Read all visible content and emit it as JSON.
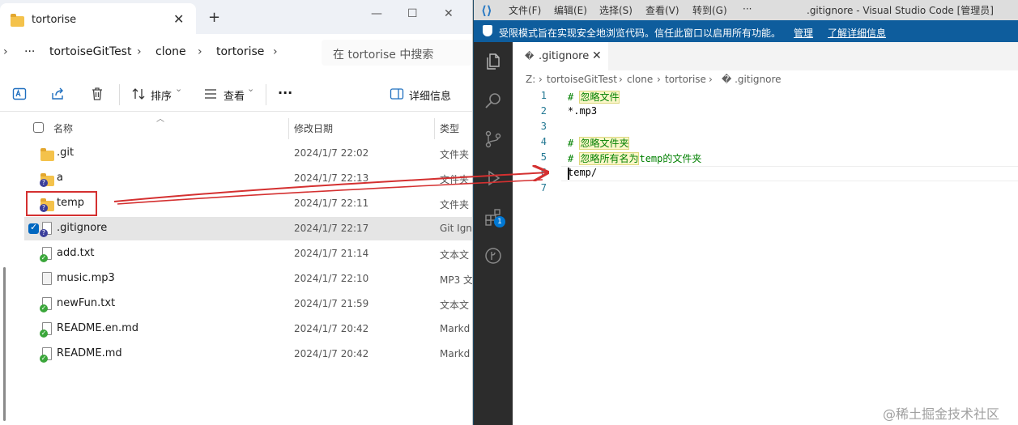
{
  "explorer": {
    "tab_title": "tortorise",
    "tab_close": "✕",
    "new_tab": "+",
    "window_controls": {
      "minimize": "—",
      "maximize": "☐",
      "close": "✕"
    },
    "breadcrumb": {
      "overflow": "···",
      "items": [
        "tortoiseGitTest",
        "clone",
        "tortorise"
      ],
      "separator": "›"
    },
    "search_placeholder": "在 tortorise 中搜索",
    "toolbar": {
      "sort_label": "排序",
      "view_label": "查看",
      "more": "···",
      "details_label": "详细信息",
      "dropdown": "⌄"
    },
    "columns": {
      "name": "名称",
      "date": "修改日期",
      "type": "类型"
    },
    "files": [
      {
        "name": ".git",
        "date": "2024/1/7 22:02",
        "type": "文件夹",
        "icon": "folder-icon",
        "overlay": "none"
      },
      {
        "name": "a",
        "date": "2024/1/7 22:13",
        "type": "文件夹",
        "icon": "folder-icon",
        "overlay": "unversioned"
      },
      {
        "name": "temp",
        "date": "2024/1/7 22:11",
        "type": "文件夹",
        "icon": "folder-icon",
        "overlay": "unversioned"
      },
      {
        "name": ".gitignore",
        "date": "2024/1/7 22:17",
        "type": "Git Ignore",
        "icon": "file-icon",
        "overlay": "unversioned",
        "selected": true
      },
      {
        "name": "add.txt",
        "date": "2024/1/7 21:14",
        "type": "文本文",
        "icon": "file-icon",
        "overlay": "normal"
      },
      {
        "name": "music.mp3",
        "date": "2024/1/7 22:10",
        "type": "MP3 文",
        "icon": "media-file-icon",
        "overlay": "none"
      },
      {
        "name": "newFun.txt",
        "date": "2024/1/7 21:59",
        "type": "文本文",
        "icon": "file-icon",
        "overlay": "normal"
      },
      {
        "name": "README.en.md",
        "date": "2024/1/7 20:42",
        "type": "Markd",
        "icon": "file-icon",
        "overlay": "normal"
      },
      {
        "name": "README.md",
        "date": "2024/1/7 20:42",
        "type": "Markd",
        "icon": "file-icon",
        "overlay": "normal"
      }
    ]
  },
  "vscode": {
    "menu": [
      "文件(F)",
      "编辑(E)",
      "选择(S)",
      "查看(V)",
      "转到(G)",
      "···"
    ],
    "window_title": ".gitignore - Visual Studio Code [管理员]",
    "banner": {
      "text": "受限模式旨在实现安全地浏览代码。信任此窗口以启用所有功能。",
      "manage_link": "管理",
      "learn_link": "了解详细信息"
    },
    "extensions_badge": "1",
    "tab": {
      "icon": "�",
      "title": ".gitignore",
      "close": "✕"
    },
    "breadcrumb": [
      "Z:",
      "tortoiseGitTest",
      "clone",
      "tortorise",
      "� .gitignore"
    ],
    "breadcrumb_sep": "›",
    "lines": [
      {
        "num": "1",
        "prefix": "# ",
        "highlight": "忽略文件",
        "suffix": "",
        "comment": true
      },
      {
        "num": "2",
        "prefix": "*.mp3",
        "highlight": "",
        "suffix": "",
        "comment": false
      },
      {
        "num": "3",
        "prefix": "",
        "highlight": "",
        "suffix": "",
        "comment": false
      },
      {
        "num": "4",
        "prefix": "# ",
        "highlight": "忽略文件夹",
        "suffix": "",
        "comment": true
      },
      {
        "num": "5",
        "prefix": "# ",
        "highlight": "忽略所有名为",
        "suffix": "temp的文件夹",
        "comment": true
      },
      {
        "num": "6",
        "prefix": "temp/",
        "highlight": "",
        "suffix": "",
        "comment": false
      },
      {
        "num": "7",
        "prefix": "",
        "highlight": "",
        "suffix": "",
        "comment": false
      }
    ]
  },
  "watermark": "@稀土掘金技术社区",
  "colors": {
    "annotation_red": "#d43030",
    "vscode_banner": "#0e5d9d",
    "accent_blue": "#0067c0"
  }
}
